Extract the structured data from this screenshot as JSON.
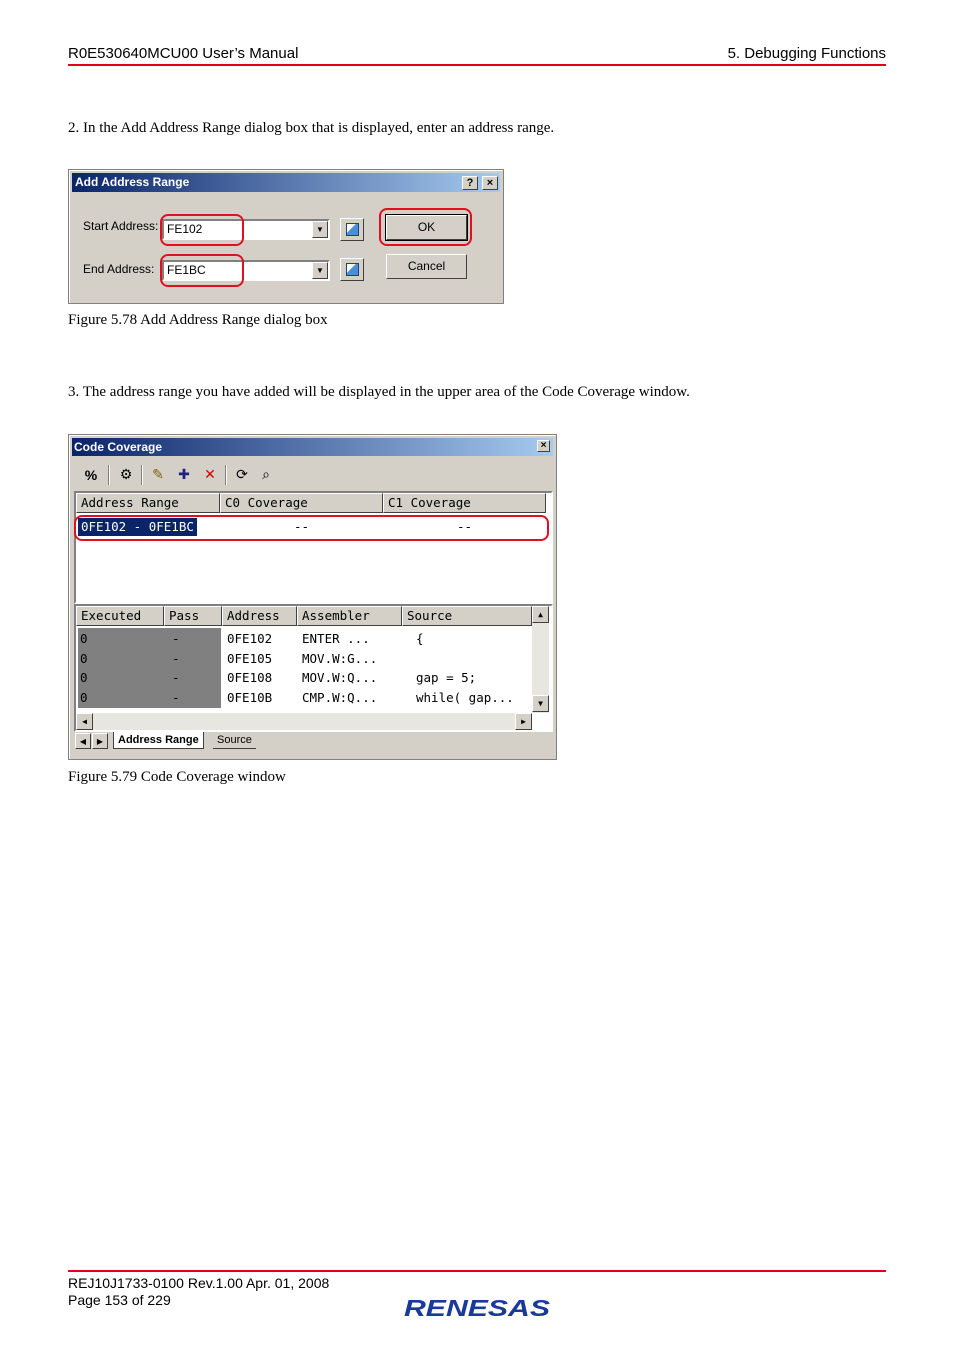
{
  "header": {
    "left": "R0E530640MCU00 User’s Manual",
    "right": "5. Debugging Functions"
  },
  "step2": "2. In the Add Address Range dialog box that is displayed, enter an address range.",
  "dialog": {
    "title": "Add Address Range",
    "help": "?",
    "close": "×",
    "start_label": "Start Address:",
    "start_value": "FE102",
    "end_label": "End Address:",
    "end_value": "FE1BC",
    "ok": "OK",
    "cancel": "Cancel"
  },
  "caption1": "Figure 5.78 Add Address Range dialog box",
  "step3": "3. The address range you have added will be displayed in the upper area of the Code Coverage window.",
  "window": {
    "title": "Code Coverage",
    "close": "×",
    "toolbar_icons": [
      "percent-icon",
      "settings-icon",
      "edit-range-icon",
      "add-range-icon",
      "delete-range-icon",
      "refresh-icon",
      "find-icon"
    ],
    "toolbar_glyphs": [
      "%",
      "⚙",
      "✎",
      "✚",
      "✕",
      "⟳",
      "⌕"
    ],
    "range_headers": [
      "Address Range",
      "C0 Coverage",
      "C1 Coverage"
    ],
    "range_row": {
      "range": "0FE102 - 0FE1BC",
      "c0": "--",
      "c1": "--"
    },
    "detail_headers": [
      "Executed",
      "Pass",
      "Address",
      "Assembler",
      "Source"
    ],
    "detail_rows": [
      {
        "executed": "0",
        "pass": "-",
        "address": "0FE102",
        "assembler": "ENTER  ...",
        "source": "{"
      },
      {
        "executed": "0",
        "pass": "-",
        "address": "0FE105",
        "assembler": "MOV.W:G...",
        "source": ""
      },
      {
        "executed": "0",
        "pass": "-",
        "address": "0FE108",
        "assembler": "MOV.W:Q...",
        "source": "gap = 5;"
      },
      {
        "executed": "0",
        "pass": "-",
        "address": "0FE10B",
        "assembler": "CMP.W:Q...",
        "source": "while( gap..."
      }
    ],
    "tabs": [
      "Address Range",
      "Source"
    ]
  },
  "caption2": "Figure 5.79 Code Coverage window",
  "footer": {
    "doc": "REJ10J1733-0100    Rev.1.00    Apr. 01, 2008",
    "page": "Page 153 of 229",
    "logo_text": "RENESAS"
  },
  "colors": {
    "rule": "#e0001a",
    "highlight": "#e01020",
    "titlebar": "#0a246a"
  }
}
